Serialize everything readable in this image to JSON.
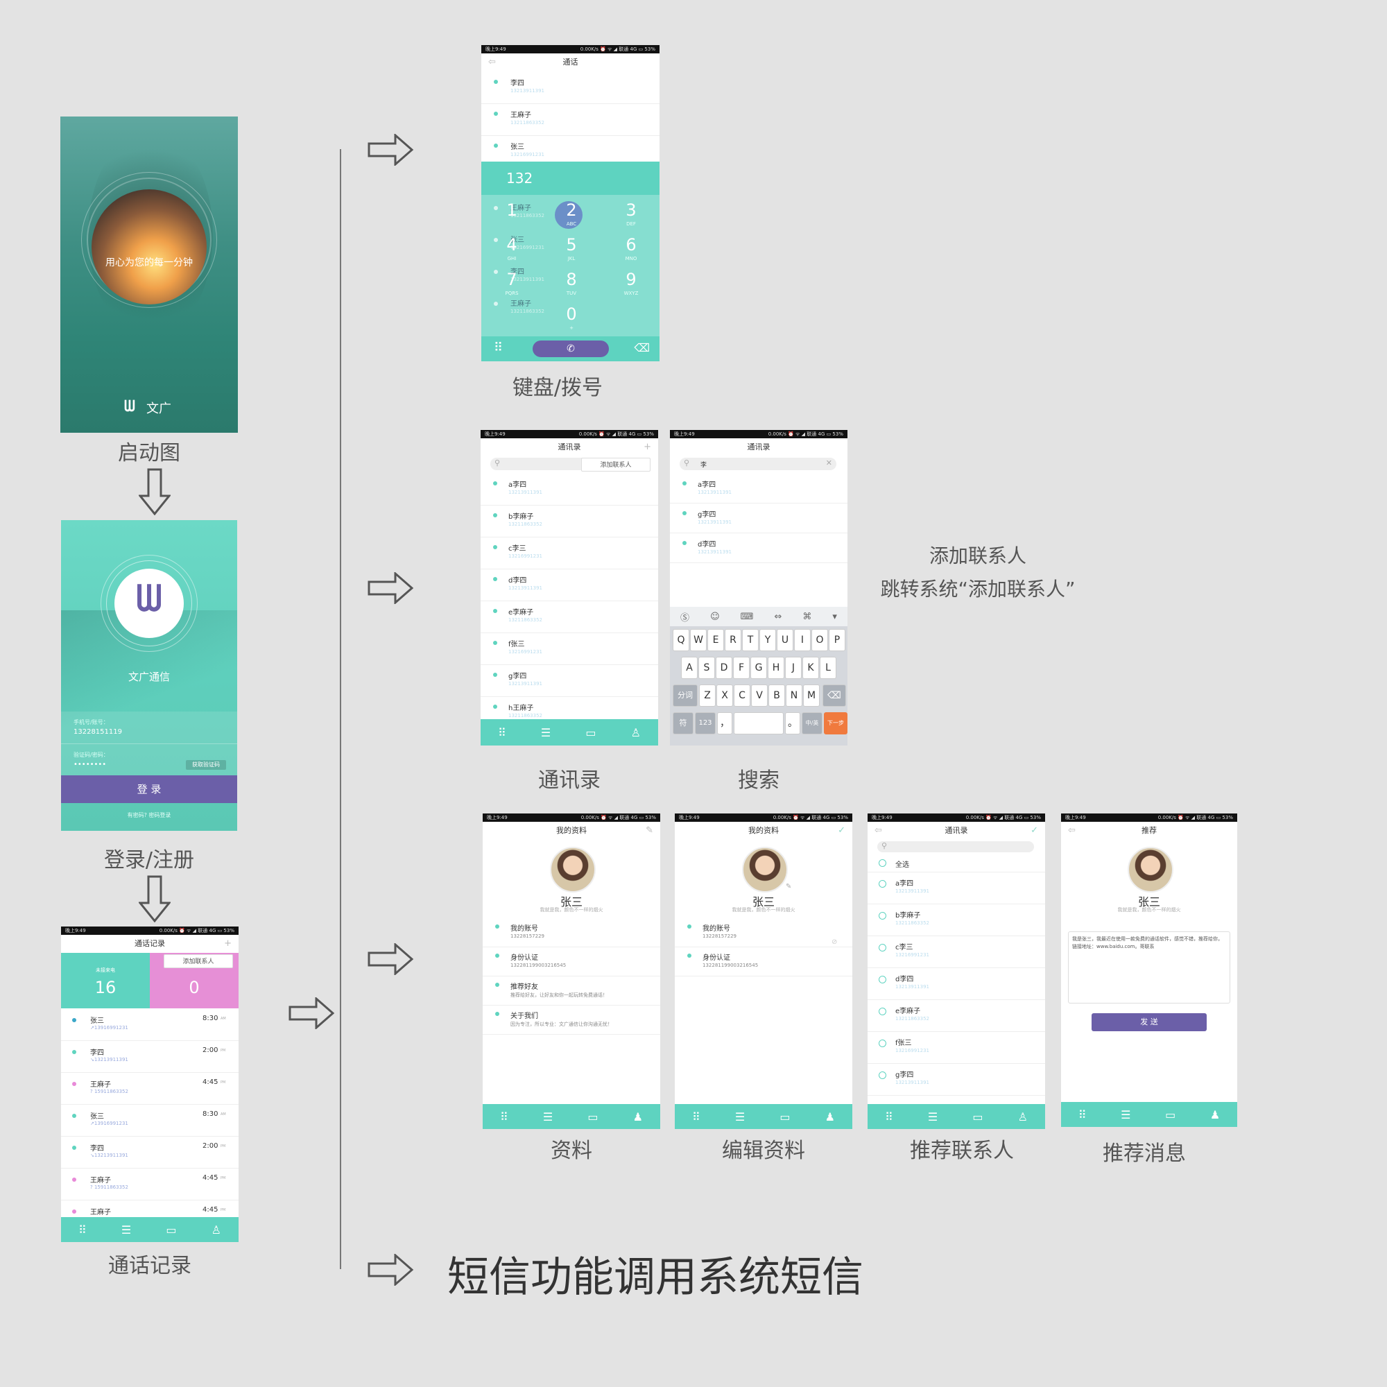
{
  "captions": {
    "splash": "启动图",
    "login": "登录/注册",
    "calllog": "通话记录",
    "dialpad": "键盘/拨号",
    "contacts": "通讯录",
    "search": "搜索",
    "profile": "资料",
    "edit_profile": "编辑资料",
    "recommend_contacts": "推荐联系人",
    "recommend_msg": "推荐消息",
    "add_contact_line1": "添加联系人",
    "add_contact_line2": "跳转系统“添加联系人”",
    "sms_note": "短信功能调用系统短信"
  },
  "status": {
    "time": "晚上9:49",
    "right": "0.00K/s ⏰ ᯤ ◢ 联通 4G ▭ 53%"
  },
  "splash": {
    "slogan": "用心为您的每一分钟",
    "brand": "文广",
    "logo_glyph": "ᗯ"
  },
  "login": {
    "app_name": "文广通信",
    "phone_label": "手机号/账号：",
    "phone_value": "13228151119",
    "code_label": "验证码/密码：",
    "code_value": "••••••••",
    "get_code": "获取验证码",
    "login_button": "登    录",
    "footer": "有密码?   密码登录"
  },
  "calllog": {
    "title": "通话记录",
    "add_contact": "添加联系人",
    "missed_label": "未接来电",
    "missed_count": "16",
    "right_count": "0",
    "rows": [
      {
        "name": "张三",
        "num": "↗13916991231",
        "time": "8:30",
        "ampm": "AM",
        "color": "#3aa7c8"
      },
      {
        "name": "李四",
        "num": "↘13213911391",
        "time": "2:00",
        "ampm": "PM",
        "color": "#5fd4bf"
      },
      {
        "name": "王麻子",
        "num": "? 15911863352",
        "time": "4:45",
        "ampm": "PM",
        "color": "#e88ad8"
      },
      {
        "name": "张三",
        "num": "↗13916991231",
        "time": "8:30",
        "ampm": "AM",
        "color": "#5fd4bf"
      },
      {
        "name": "李四",
        "num": "↘13213911391",
        "time": "2:00",
        "ampm": "PM",
        "color": "#5fd4bf"
      },
      {
        "name": "王麻子",
        "num": "? 15911863352",
        "time": "4:45",
        "ampm": "PM",
        "color": "#e88ad8"
      },
      {
        "name": "王麻子",
        "num": "",
        "time": "4:45",
        "ampm": "PM",
        "color": "#e88ad8"
      }
    ]
  },
  "dialpad": {
    "title": "通话",
    "contacts": [
      {
        "name": "李四",
        "num": "13213911391"
      },
      {
        "name": "王麻子",
        "num": "13211863352"
      },
      {
        "name": "张三",
        "num": "13216991231"
      }
    ],
    "input": "132",
    "overlay": [
      {
        "name": "王麻子",
        "num": "13211863352"
      },
      {
        "name": "张三",
        "num": "13216991231"
      },
      {
        "name": "李四",
        "num": "13213911391"
      },
      {
        "name": "王麻子",
        "num": "13211863352"
      }
    ],
    "keys": [
      {
        "n": "1",
        "s": ""
      },
      {
        "n": "2",
        "s": "ABC"
      },
      {
        "n": "3",
        "s": "DEF"
      },
      {
        "n": "4",
        "s": "GHI"
      },
      {
        "n": "5",
        "s": "JKL"
      },
      {
        "n": "6",
        "s": "MNO"
      },
      {
        "n": "7",
        "s": "PQRS"
      },
      {
        "n": "8",
        "s": "TUV"
      },
      {
        "n": "9",
        "s": "WXYZ"
      },
      {
        "n": "0",
        "s": "+"
      }
    ]
  },
  "contacts": {
    "title": "通讯录",
    "add_contact": "添加联系人",
    "rows": [
      {
        "name": "a李四",
        "num": "13213911391"
      },
      {
        "name": "b李麻子",
        "num": "13211863352"
      },
      {
        "name": "c李三",
        "num": "13216991231"
      },
      {
        "name": "d李四",
        "num": "13213911391"
      },
      {
        "name": "e李麻子",
        "num": "13211863352"
      },
      {
        "name": "f张三",
        "num": "13216991231"
      },
      {
        "name": "g李四",
        "num": "13213911391"
      },
      {
        "name": "h王麻子",
        "num": "13211863352"
      }
    ]
  },
  "search": {
    "title": "通讯录",
    "query": "李",
    "rows": [
      {
        "name": "a李四",
        "num": "13213911391"
      },
      {
        "name": "g李四",
        "num": "13213911391"
      },
      {
        "name": "d李四",
        "num": "13213911391"
      }
    ],
    "kb_row1": [
      "Q",
      "W",
      "E",
      "R",
      "T",
      "Y",
      "U",
      "I",
      "O",
      "P"
    ],
    "kb_row2": [
      "A",
      "S",
      "D",
      "F",
      "G",
      "H",
      "J",
      "K",
      "L"
    ],
    "kb_row3": [
      "Z",
      "X",
      "C",
      "V",
      "B",
      "N",
      "M"
    ],
    "kb_fenci": "分词",
    "kb_fu": "符",
    "kb_123": "123",
    "kb_comma": "，",
    "kb_period": "。",
    "kb_zh": "中/英",
    "kb_next": "下一步"
  },
  "profile": {
    "title": "我的资料",
    "name": "张三",
    "motto": "我就是我，颜色不一样的烟火",
    "items": [
      {
        "label": "我的账号",
        "value": "13228157229"
      },
      {
        "label": "身份认证",
        "value": "132281199003216545"
      },
      {
        "label": "推荐好友",
        "value": "推荐给好友，让好友和你一起玩转免费通话！"
      },
      {
        "label": "关于我们",
        "value": "因为专注，所以专业：文广通信让你沟通无忧！"
      }
    ]
  },
  "edit_profile": {
    "title": "我的资料",
    "name": "张三",
    "motto": "我就是我，颜色不一样的烟火",
    "items": [
      {
        "label": "我的账号",
        "value": "13228157229"
      },
      {
        "label": "身份认证",
        "value": "132281199003216545"
      }
    ]
  },
  "recommend_contacts": {
    "title": "通讯录",
    "select_all": "全选",
    "rows": [
      {
        "name": "a李四",
        "num": "13213911391"
      },
      {
        "name": "b李麻子",
        "num": "13211863352"
      },
      {
        "name": "c李三",
        "num": "13216991231"
      },
      {
        "name": "d李四",
        "num": "13213911391"
      },
      {
        "name": "e李麻子",
        "num": "13211863352"
      },
      {
        "name": "f张三",
        "num": "13216991231"
      },
      {
        "name": "g李四",
        "num": "13213911391"
      }
    ]
  },
  "recommend_msg": {
    "title": "推荐",
    "name": "张三",
    "motto": "我就是我，颜色不一样的烟火",
    "message": "我是张三，我最近在使用一款免费的通话软件，感觉不错，推荐给你，链接地址：www.baidu.com。哥联系",
    "send": "发  送"
  },
  "colors": {
    "teal": "#5ed3c0",
    "purple": "#6b5fa8",
    "pink": "#e68fd6",
    "orange": "#f07a3e"
  }
}
